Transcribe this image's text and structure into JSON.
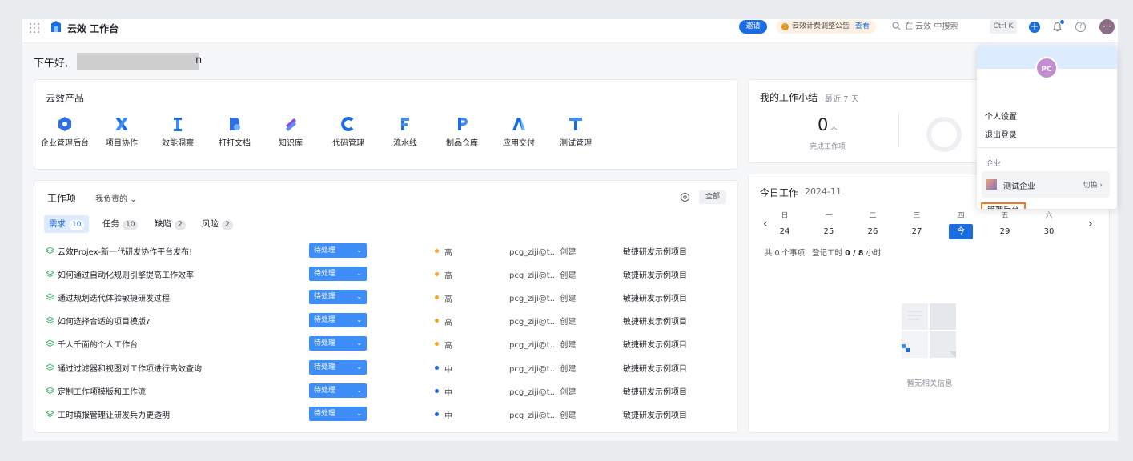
{
  "header": {
    "app_title": "云效 工作台",
    "invite_label": "邀请",
    "notice_text": "云效计费调整公告",
    "notice_link": "查看",
    "search_placeholder": "在 云效 中搜索",
    "shortcut": "Ctrl K",
    "plus_label": "+",
    "help_label": "?",
    "avatar_initials": "•••"
  },
  "greeting": {
    "prefix": "下午好,",
    "suffix": "n"
  },
  "products": {
    "title": "云效产品",
    "items": [
      {
        "label": "企业管理后台",
        "icon": "enterprise-admin-icon"
      },
      {
        "label": "项目协作",
        "icon": "project-collab-icon"
      },
      {
        "label": "效能洞察",
        "icon": "insight-icon"
      },
      {
        "label": "打打文档",
        "icon": "docs-icon"
      },
      {
        "label": "知识库",
        "icon": "knowledge-base-icon"
      },
      {
        "label": "代码管理",
        "icon": "code-icon"
      },
      {
        "label": "流水线",
        "icon": "pipeline-icon"
      },
      {
        "label": "制品仓库",
        "icon": "package-icon"
      },
      {
        "label": "应用交付",
        "icon": "app-delivery-icon"
      },
      {
        "label": "测试管理",
        "icon": "test-icon"
      }
    ]
  },
  "work_items": {
    "title": "工作项",
    "owner_filter": "我负责的",
    "all_label": "全部",
    "tabs": [
      {
        "label": "需求",
        "count": "10"
      },
      {
        "label": "任务",
        "count": "10"
      },
      {
        "label": "缺陷",
        "count": "2"
      },
      {
        "label": "风险",
        "count": "2"
      }
    ],
    "rows": [
      {
        "title": "云效Projex-新一代研发协作平台发布!",
        "status": "待处理",
        "priority": "高",
        "priority_color": "#f5a623",
        "creator": "pcg_ziji@t... 创建",
        "project": "敏捷研发示例项目"
      },
      {
        "title": "如何通过自动化规则引擎提高工作效率",
        "status": "待处理",
        "priority": "高",
        "priority_color": "#f5a623",
        "creator": "pcg_ziji@t... 创建",
        "project": "敏捷研发示例项目"
      },
      {
        "title": "通过规划迭代体验敏捷研发过程",
        "status": "待处理",
        "priority": "高",
        "priority_color": "#f5a623",
        "creator": "pcg_ziji@t... 创建",
        "project": "敏捷研发示例项目"
      },
      {
        "title": "如何选择合适的项目模版?",
        "status": "待处理",
        "priority": "高",
        "priority_color": "#f5a623",
        "creator": "pcg_ziji@t... 创建",
        "project": "敏捷研发示例项目"
      },
      {
        "title": "千人千面的个人工作台",
        "status": "待处理",
        "priority": "高",
        "priority_color": "#f5a623",
        "creator": "pcg_ziji@t... 创建",
        "project": "敏捷研发示例项目"
      },
      {
        "title": "通过过滤器和视图对工作项进行高效查询",
        "status": "待处理",
        "priority": "中",
        "priority_color": "#1b6ce0",
        "creator": "pcg_ziji@t... 创建",
        "project": "敏捷研发示例项目"
      },
      {
        "title": "定制工作项模版和工作流",
        "status": "待处理",
        "priority": "中",
        "priority_color": "#1b6ce0",
        "creator": "pcg_ziji@t... 创建",
        "project": "敏捷研发示例项目"
      },
      {
        "title": "工时填报管理让研发兵力更透明",
        "status": "待处理",
        "priority": "中",
        "priority_color": "#1b6ce0",
        "creator": "pcg_ziji@t... 创建",
        "project": "敏捷研发示例项目"
      }
    ]
  },
  "summary": {
    "title": "我的工作小结",
    "period": "最近 7 天",
    "count": "0",
    "unit": "个",
    "label": "完成工作项"
  },
  "today": {
    "title": "今日工作",
    "month": "2024-11",
    "weekdays": [
      "日",
      "一",
      "二",
      "三",
      "四",
      "五",
      "六"
    ],
    "days": [
      "24",
      "25",
      "26",
      "27",
      "今",
      "29",
      "30"
    ],
    "current_index": 4,
    "events_prefix": "共 0 个事项",
    "hours_prefix": "登记工时",
    "hours_value": "0 / 8",
    "hours_suffix": "小时",
    "empty_text": "暂无相关信息"
  },
  "user_menu": {
    "avatar_initials": "PC",
    "settings": "个人设置",
    "logout": "退出登录",
    "enterprise_label": "企业",
    "org_name": "测试企业",
    "switch_label": "切换",
    "admin_label": "管理后台"
  },
  "colors": {
    "brand": "#1b6ce0",
    "status_button": "#3d8ef8",
    "highlight_border": "#f07a1e"
  }
}
